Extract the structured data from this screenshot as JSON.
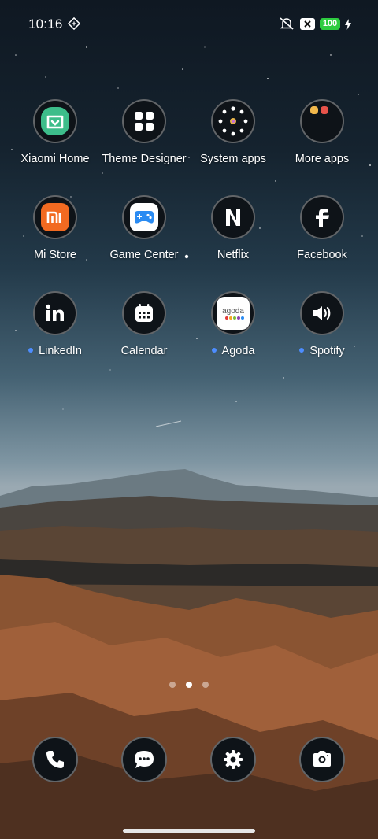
{
  "status_bar": {
    "time": "10:16",
    "battery": "100"
  },
  "apps": [
    {
      "label": "Xiaomi Home",
      "icon": "xiaomi-home-icon",
      "new_dot": false
    },
    {
      "label": "Theme Designer",
      "icon": "theme-designer-icon",
      "new_dot": false
    },
    {
      "label": "System apps",
      "icon": "system-apps-folder-icon",
      "new_dot": false
    },
    {
      "label": "More apps",
      "icon": "more-apps-folder-icon",
      "new_dot": false
    },
    {
      "label": "Mi Store",
      "icon": "mi-store-icon",
      "new_dot": false
    },
    {
      "label": "Game Center",
      "icon": "game-center-icon",
      "new_dot": false
    },
    {
      "label": "Netflix",
      "icon": "netflix-icon",
      "new_dot": false
    },
    {
      "label": "Facebook",
      "icon": "facebook-icon",
      "new_dot": false
    },
    {
      "label": "LinkedIn",
      "icon": "linkedin-icon",
      "new_dot": true
    },
    {
      "label": "Calendar",
      "icon": "calendar-icon",
      "new_dot": false
    },
    {
      "label": "Agoda",
      "icon": "agoda-icon",
      "new_dot": true,
      "logo_text": "agoda"
    },
    {
      "label": "Spotify",
      "icon": "spotify-icon",
      "new_dot": true
    }
  ],
  "pager": {
    "pages": 3,
    "current": 2
  },
  "dock": [
    {
      "icon": "phone-icon"
    },
    {
      "icon": "messages-icon"
    },
    {
      "icon": "settings-icon"
    },
    {
      "icon": "camera-icon"
    }
  ],
  "colors": {
    "accent_dot": "#4d8dff",
    "battery": "#2ecc40",
    "icon_bg": "#0e1318"
  }
}
